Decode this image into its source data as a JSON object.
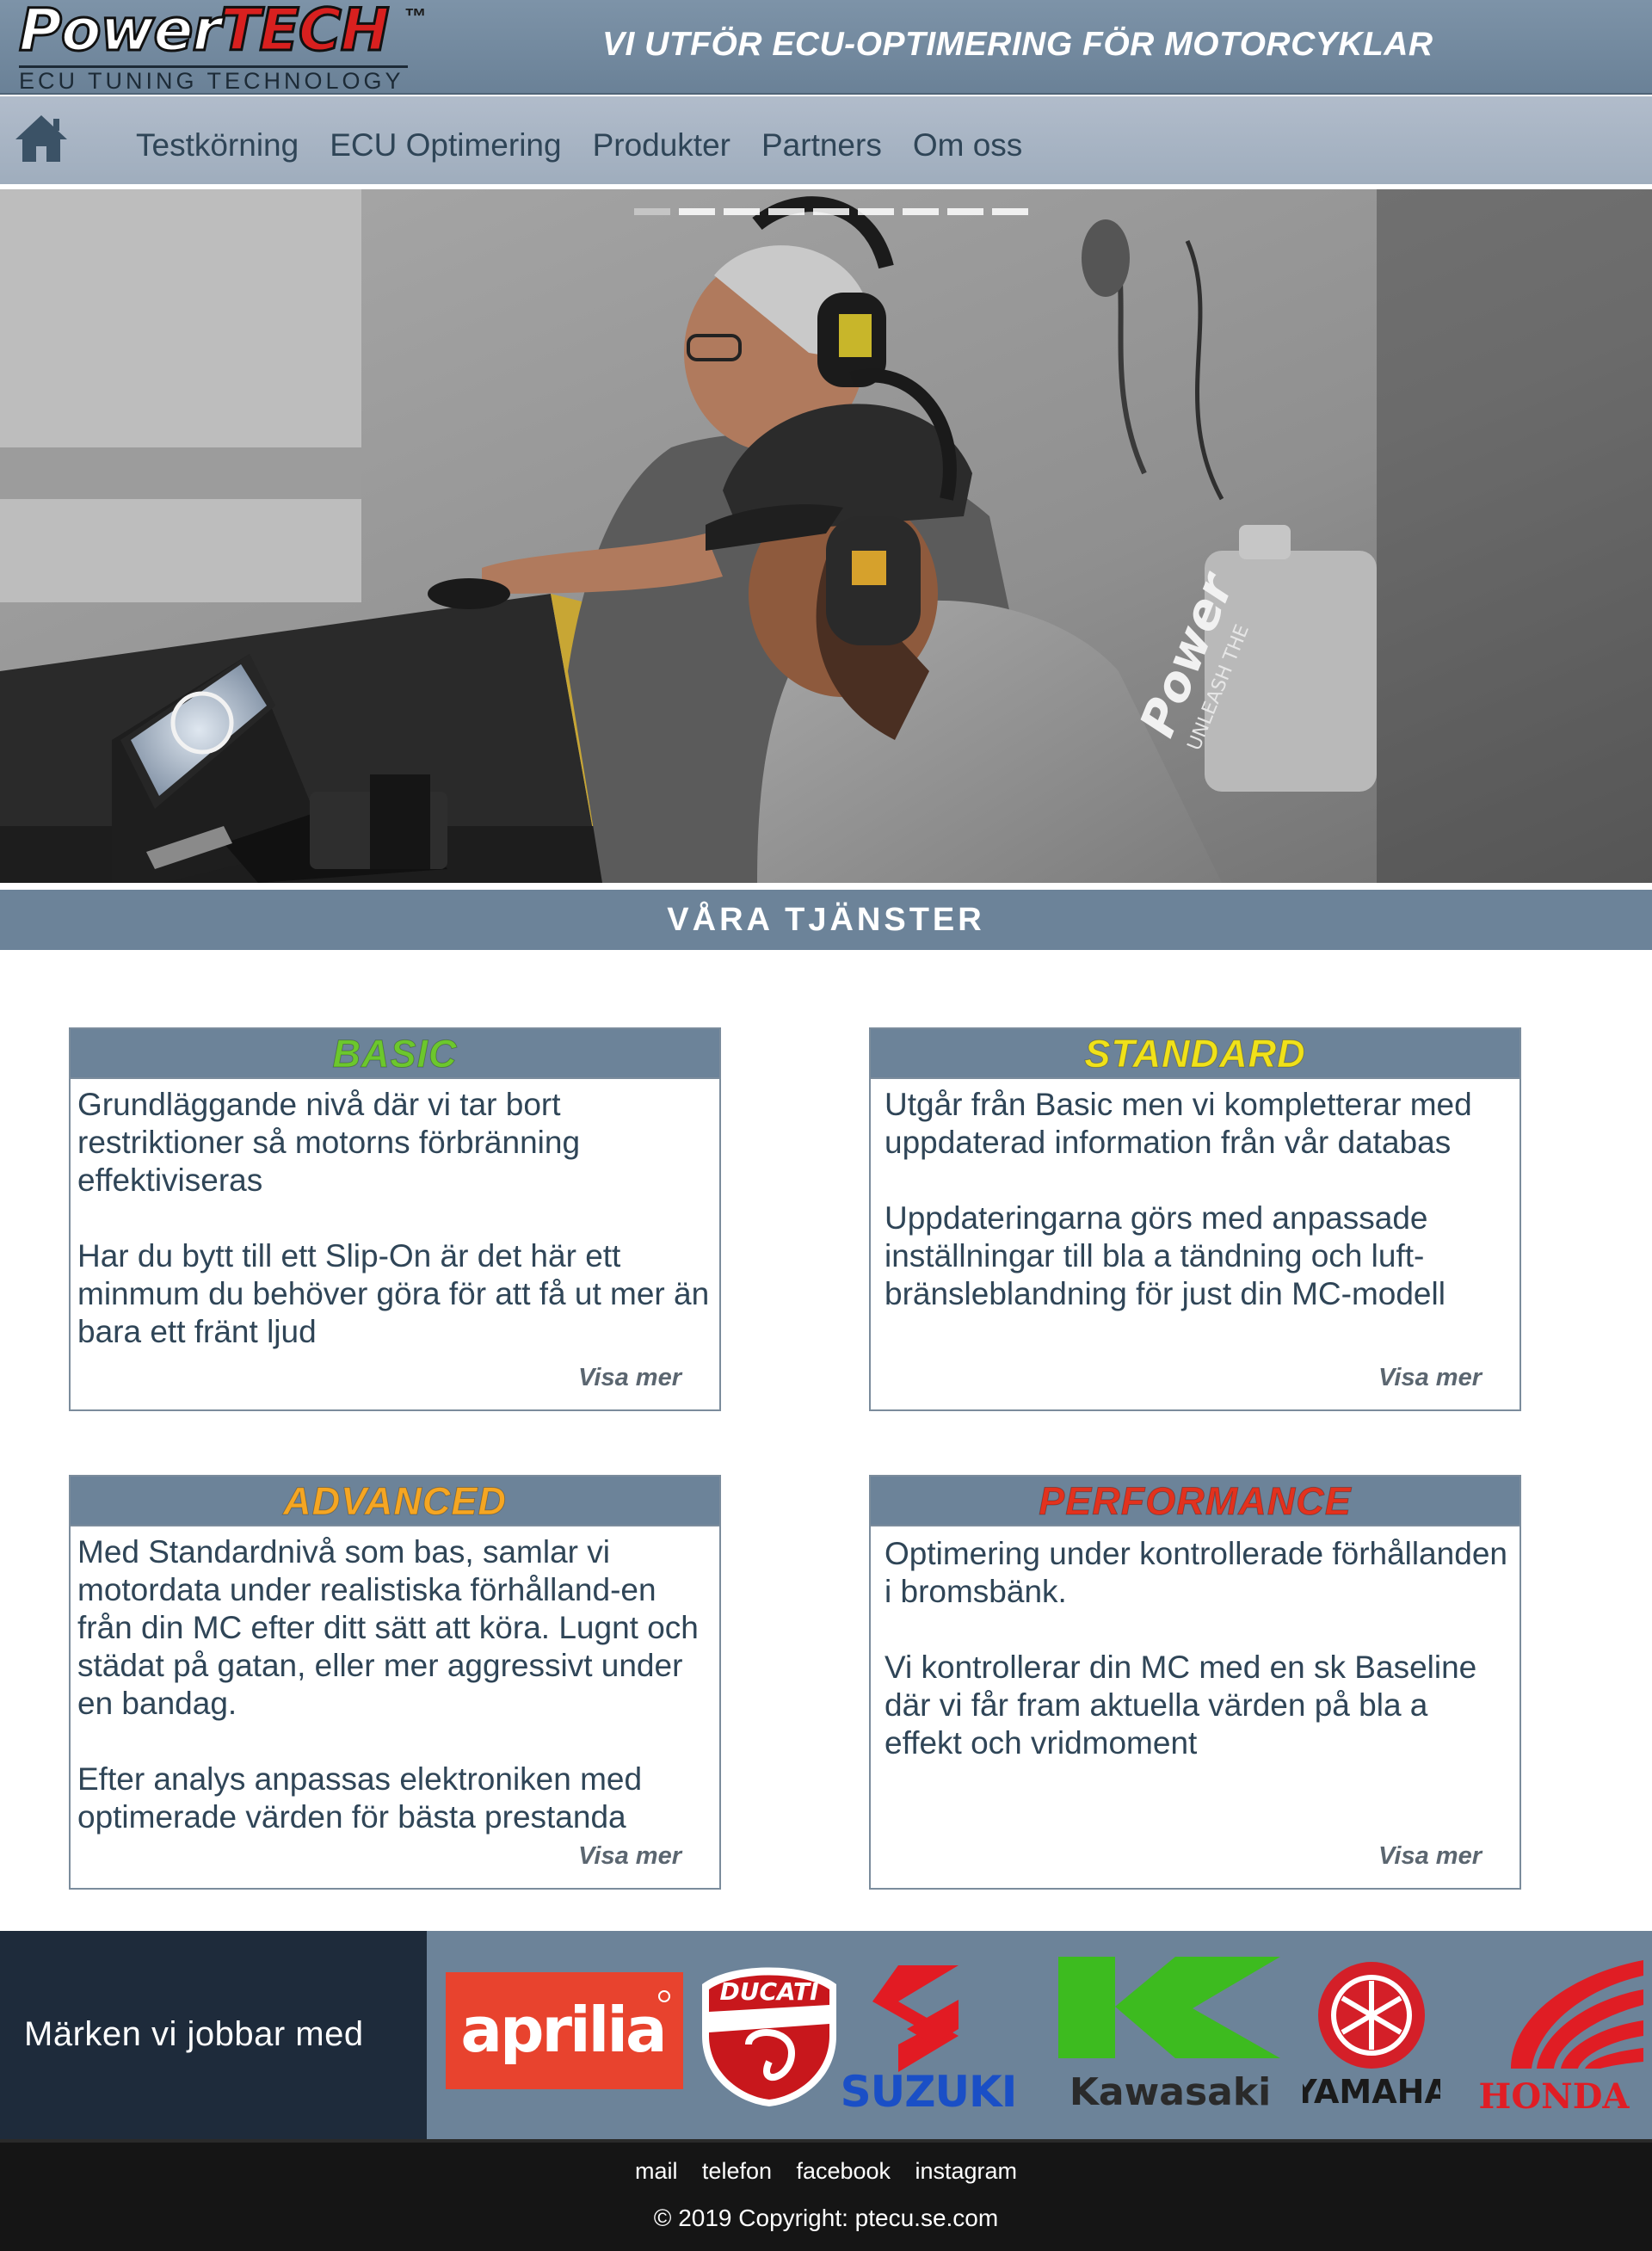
{
  "header": {
    "logo_power": "Power",
    "logo_tech": "TECH",
    "logo_tm": "™",
    "logo_subtitle": "ECU TUNING TECHNOLOGY",
    "tagline": "VI UTFÖR ECU-OPTIMERING FÖR MOTORCYKLAR"
  },
  "nav": {
    "home_icon": "home-icon",
    "items": [
      {
        "label": "Testkörning"
      },
      {
        "label": "ECU Optimering"
      },
      {
        "label": "Produkter"
      },
      {
        "label": "Partners"
      },
      {
        "label": "Om oss"
      }
    ]
  },
  "hero": {
    "slide_count": 9,
    "active_slide": 1,
    "shirt_print": "Power",
    "shirt_print_small": "UNLEASH THE"
  },
  "services": {
    "title": "VÅRA TJÄNSTER",
    "cards": [
      {
        "title": "BASIC",
        "title_color": "#6cc72d",
        "paragraphs": [
          "Grundläggande nivå där vi tar bort restriktioner så motorns förbränning effektiviseras",
          "Har du bytt till ett Slip-On är det här ett minmum du behöver göra för att få ut mer än bara ett fränt ljud"
        ],
        "more": "Visa mer"
      },
      {
        "title": "STANDARD",
        "title_color": "#f0e11a",
        "paragraphs": [
          "Utgår från Basic men vi kompletterar med uppdaterad information från vår databas",
          "Uppdateringarna görs med anpassade inställningar till bla a tändning och luft-bränsleblandning för just din MC-modell"
        ],
        "more": "Visa mer"
      },
      {
        "title": "ADVANCED",
        "title_color": "#f5a623",
        "paragraphs": [
          "Med Standardnivå  som bas, samlar vi motordata under realistiska förhålland-en från din MC efter ditt sätt att köra. Lugnt och städat på gatan, eller mer aggressivt under en bandag.",
          "Efter analys anpassas elektroniken med optimerade värden för bästa prestanda"
        ],
        "more": "Visa mer"
      },
      {
        "title": "PERFORMANCE",
        "title_color": "#e2321e",
        "paragraphs": [
          "Optimering under kontrollerade förhållanden i bromsbänk.",
          "Vi kontrollerar din MC med en sk Baseline där vi får fram aktuella värden på bla a effekt och vridmoment"
        ],
        "more": "Visa mer"
      }
    ]
  },
  "brands": {
    "label": "Märken vi jobbar med",
    "items": [
      {
        "name": "aprilia",
        "color": "#e8432e"
      },
      {
        "name": "DUCATI",
        "color": "#c8171c"
      },
      {
        "name": "SUZUKI",
        "color": "#e21b23"
      },
      {
        "name": "Kawasaki",
        "color": "#3dbb1f"
      },
      {
        "name": "YAMAHA",
        "color": "#d41f28"
      },
      {
        "name": "HONDA",
        "color": "#e01d24"
      }
    ]
  },
  "footer": {
    "links": [
      "mail",
      "telefon",
      "facebook",
      "instagram"
    ],
    "copyright": "© 2019 Copyright: ptecu.se.com"
  }
}
